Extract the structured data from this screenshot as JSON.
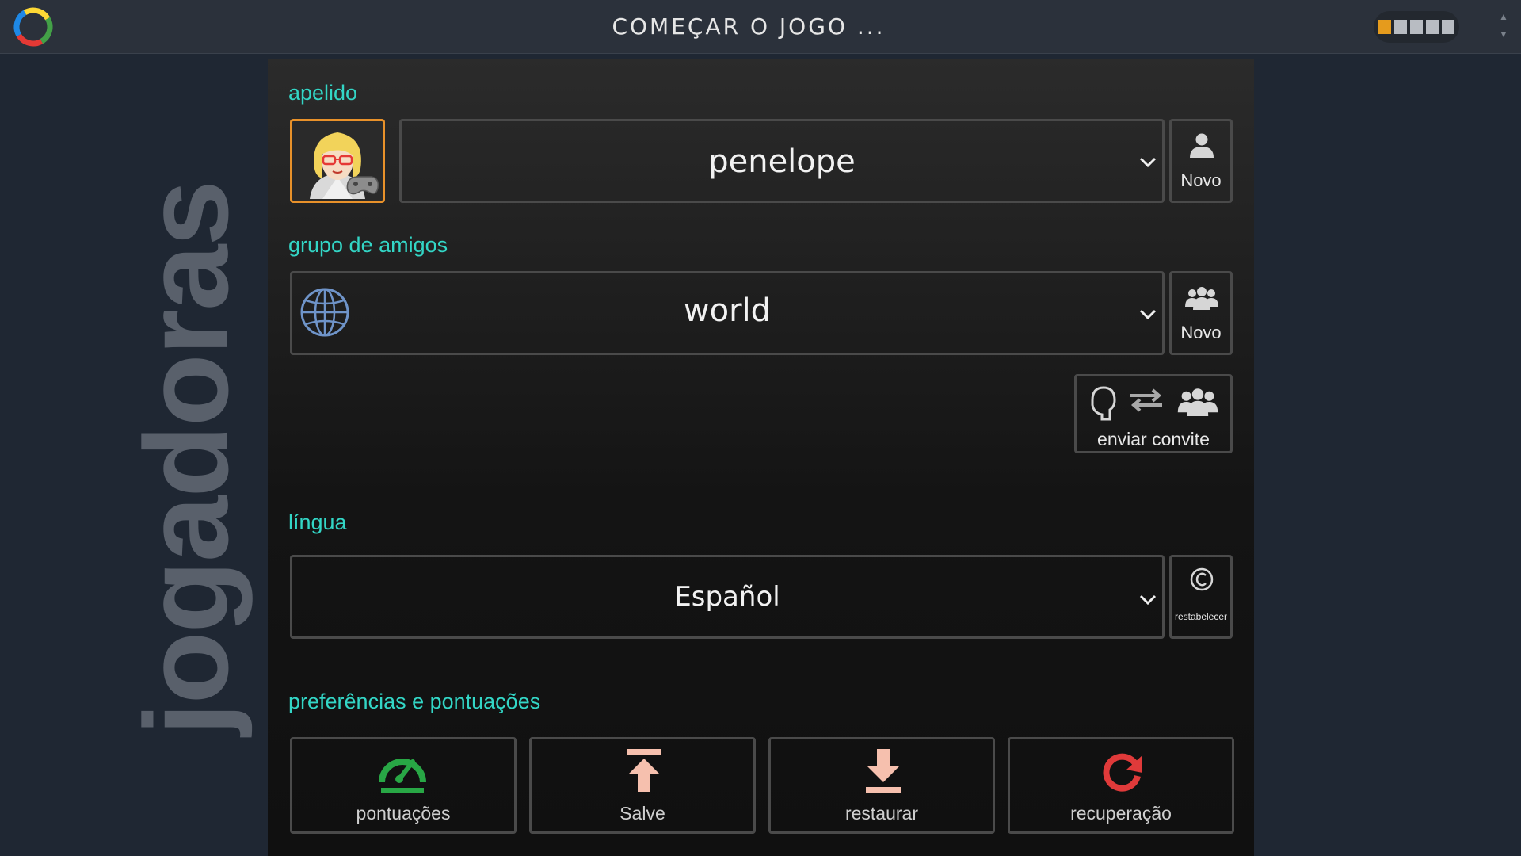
{
  "header": {
    "title": "COMEÇAR O JOGO ...",
    "tiles": [
      true,
      false,
      false,
      false,
      false
    ],
    "accent": "#e59b1d"
  },
  "side": {
    "text": "jogadoras"
  },
  "nickname": {
    "label": "apelido",
    "value": "penelope",
    "new_label": "Novo",
    "avatar_icon": "blonde-woman-avatar-icon"
  },
  "group": {
    "label": "grupo de amigos",
    "value": "world",
    "new_label": "Novo",
    "invite_label": "enviar convite"
  },
  "language": {
    "label": "língua",
    "value": "Español",
    "reset_label": "restabelecer"
  },
  "prefs": {
    "label": "preferências e pontuações",
    "buttons": [
      {
        "label": "pontuações",
        "icon": "speedometer-icon",
        "color": "#28a745"
      },
      {
        "label": "Salve",
        "icon": "upload-icon",
        "color": "#f6c0ae"
      },
      {
        "label": "restaurar",
        "icon": "download-icon",
        "color": "#f6c0ae"
      },
      {
        "label": "recuperação",
        "icon": "refresh-icon",
        "color": "#e03a3a"
      }
    ]
  },
  "colors": {
    "section_label": "#33d6c6",
    "border": "#4a4a4a"
  }
}
